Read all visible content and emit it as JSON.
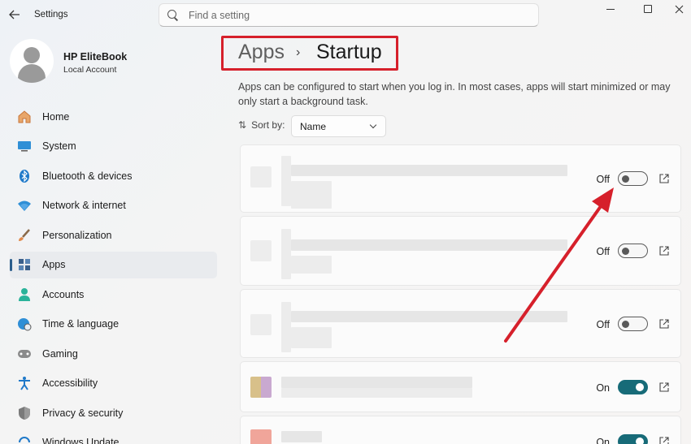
{
  "window": {
    "title": "Settings"
  },
  "search": {
    "placeholder": "Find a setting"
  },
  "profile": {
    "name": "HP EliteBook",
    "subtitle": "Local Account"
  },
  "sidebar": {
    "items": [
      {
        "label": "Home",
        "icon": "home-icon",
        "active": false
      },
      {
        "label": "System",
        "icon": "monitor-icon",
        "active": false
      },
      {
        "label": "Bluetooth & devices",
        "icon": "bluetooth-icon",
        "active": false
      },
      {
        "label": "Network & internet",
        "icon": "wifi-icon",
        "active": false
      },
      {
        "label": "Personalization",
        "icon": "brush-icon",
        "active": false
      },
      {
        "label": "Apps",
        "icon": "apps-icon",
        "active": true
      },
      {
        "label": "Accounts",
        "icon": "person-icon",
        "active": false
      },
      {
        "label": "Time & language",
        "icon": "globe-clock-icon",
        "active": false
      },
      {
        "label": "Gaming",
        "icon": "gamepad-icon",
        "active": false
      },
      {
        "label": "Accessibility",
        "icon": "accessibility-icon",
        "active": false
      },
      {
        "label": "Privacy & security",
        "icon": "shield-icon",
        "active": false
      },
      {
        "label": "Windows Update",
        "icon": "update-icon",
        "active": false
      }
    ]
  },
  "breadcrumb": {
    "parent": "Apps",
    "separator": "›",
    "current": "Startup"
  },
  "main": {
    "description": "Apps can be configured to start when you log in. In most cases, apps will start minimized or may only start a background task.",
    "sort_label": "Sort by:",
    "sort_value": "Name"
  },
  "startup_apps": [
    {
      "state": "Off",
      "enabled": false
    },
    {
      "state": "Off",
      "enabled": false
    },
    {
      "state": "Off",
      "enabled": false
    },
    {
      "state": "On",
      "enabled": true
    },
    {
      "state": "On",
      "enabled": true
    }
  ],
  "colors": {
    "accent": "#176b78",
    "annotation_red": "#d6202b",
    "nav_indicator": "#2a5d8c"
  }
}
